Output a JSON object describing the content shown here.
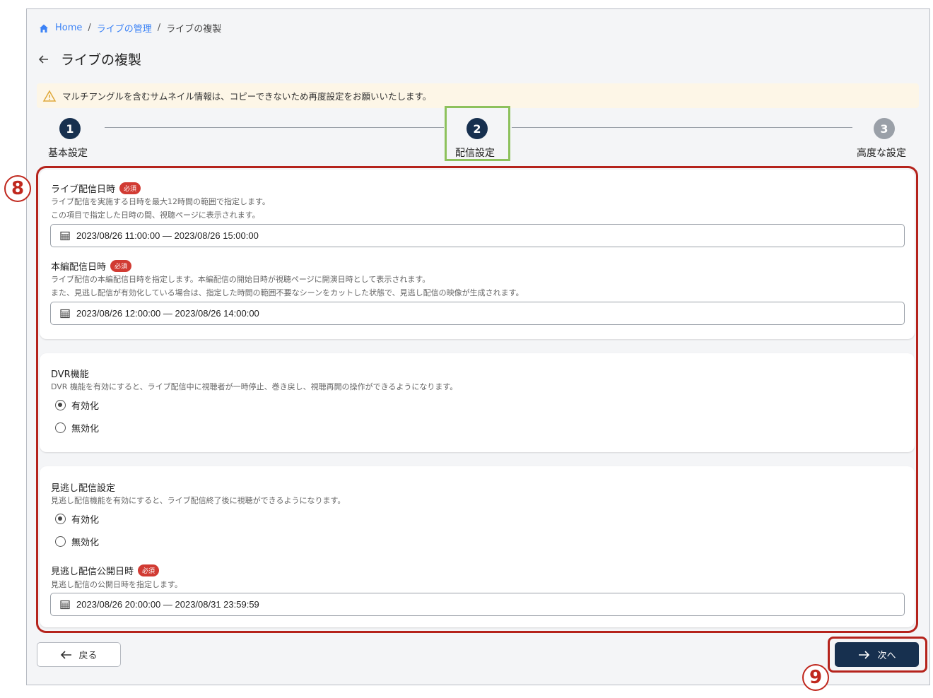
{
  "breadcrumb": {
    "home": "Home",
    "sep": "/",
    "parent": "ライブの管理",
    "current": "ライブの複製"
  },
  "page": {
    "title": "ライブの複製"
  },
  "alert": {
    "text": "マルチアングルを含むサムネイル情報は、コピーできないため再度設定をお願いいたします。"
  },
  "stepper": {
    "steps": [
      {
        "number": "1",
        "label": "基本設定"
      },
      {
        "number": "2",
        "label": "配信設定"
      },
      {
        "number": "3",
        "label": "高度な設定"
      }
    ],
    "active_index": 1
  },
  "markers": {
    "area": "8",
    "next": "9"
  },
  "schedule": {
    "live": {
      "label": "ライブ配信日時",
      "required": "必須",
      "help1": "ライブ配信を実施する日時を最大12時間の範囲で指定します。",
      "help2": "この項目で指定した日時の間、視聴ページに表示されます。",
      "value": "2023/08/26 11:00:00 — 2023/08/26 15:00:00"
    },
    "main": {
      "label": "本編配信日時",
      "required": "必須",
      "help1": "ライブ配信の本編配信日時を指定します。本編配信の開始日時が視聴ページに開演日時として表示されます。",
      "help2": "また、見逃し配信が有効化している場合は、指定した時間の範囲不要なシーンをカットした状態で、見逃し配信の映像が生成されます。",
      "value": "2023/08/26 12:00:00 — 2023/08/26 14:00:00"
    }
  },
  "dvr": {
    "label": "DVR機能",
    "help": "DVR 機能を有効にすると、ライブ配信中に視聴者が一時停止、巻き戻し、視聴再開の操作ができるようになります。",
    "options": [
      "有効化",
      "無効化"
    ],
    "selected": "有効化"
  },
  "archive": {
    "label": "見逃し配信設定",
    "help": "見逃し配信機能を有効にすると、ライブ配信終了後に視聴ができるようになります。",
    "options": [
      "有効化",
      "無効化"
    ],
    "selected": "有効化",
    "publish": {
      "label": "見逃し配信公開日時",
      "required": "必須",
      "help": "見逃し配信の公開日時を指定します。",
      "value": "2023/08/26 20:00:00 — 2023/08/31 23:59:59"
    }
  },
  "buttons": {
    "back": "戻る",
    "next": "次へ"
  },
  "colors": {
    "primary": "#17304f",
    "link": "#3b82f6",
    "required": "#d13b33",
    "highlight_red": "#b5231c",
    "highlight_green": "#8dc15c",
    "inactive_step": "#9aa0a8"
  }
}
